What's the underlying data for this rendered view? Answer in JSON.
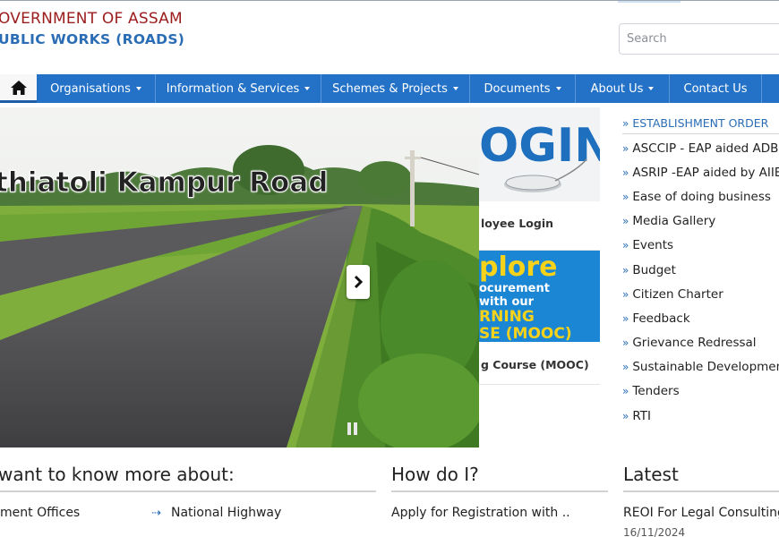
{
  "header": {
    "org_line1": "OVERNMENT OF ASSAM",
    "org_line2": "UBLIC WORKS (ROADS)",
    "search_placeholder": "Search"
  },
  "nav": {
    "home_icon": "home-icon",
    "items": [
      {
        "label": "Organisations",
        "dropdown": true
      },
      {
        "label": "Information & Services",
        "dropdown": true
      },
      {
        "label": "Schemes & Projects",
        "dropdown": true
      },
      {
        "label": "Documents",
        "dropdown": true
      },
      {
        "label": "About Us",
        "dropdown": true
      },
      {
        "label": "Contact Us",
        "dropdown": false
      }
    ]
  },
  "slider": {
    "caption": "thiatoli Kampur Road"
  },
  "cards": [
    {
      "image_text": "OGIN",
      "label": "loyee Login"
    },
    {
      "image_lines": [
        "plore",
        "ocurement",
        "with our",
        "RNING",
        "SE (MOOC)"
      ],
      "label": "g Course (MOOC)"
    }
  ],
  "sidebar": {
    "items": [
      "ESTABLISHMENT ORDER",
      "ASCCIP - EAP aided ADB",
      "ASRIP -EAP aided by AIIB",
      "Ease of doing business",
      "Media Gallery",
      "Events",
      "Budget",
      "Citizen Charter",
      "Feedback",
      "Grievance Redressal",
      "Sustainable Development",
      "Tenders",
      "RTI"
    ]
  },
  "sections": {
    "know_more": {
      "title": "want to know more about:",
      "links": [
        "ment Offices",
        "National Highway"
      ]
    },
    "how_do_i": {
      "title": "How do I?",
      "links": [
        "Apply for Registration with .."
      ]
    },
    "latest": {
      "title": "Latest",
      "items": [
        {
          "text": "REOI For Legal Consulting",
          "date": "16/11/2024"
        }
      ]
    }
  },
  "colors": {
    "nav_bg": "#2472c8",
    "brand_red": "#9b1c1c",
    "brand_blue": "#2a6db5"
  }
}
